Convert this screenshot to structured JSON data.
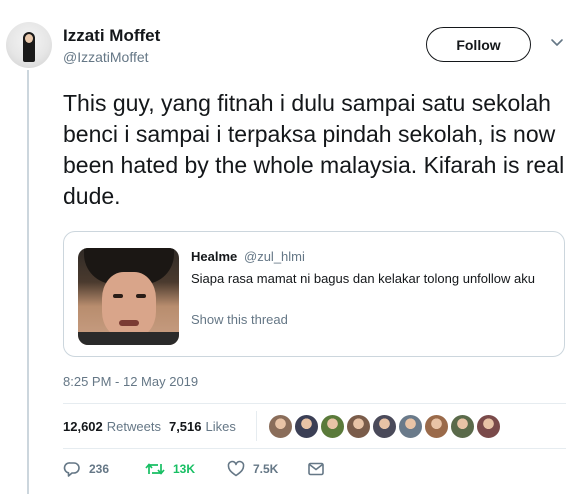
{
  "user": {
    "name": "Izzati Moffet",
    "handle": "@IzzatiMoffet",
    "follow_label": "Follow"
  },
  "tweet": {
    "text": "This guy, yang fitnah i dulu sampai satu sekolah benci i sampai i terpaksa pindah sekolah, is now been hated by the whole malaysia. Kifarah is real dude.",
    "timestamp": "8:25 PM - 12 May 2019"
  },
  "quoted": {
    "name": "Healme",
    "handle": "@zul_hlmi",
    "text": "Siapa rasa mamat ni bagus dan kelakar tolong unfollow aku",
    "show_thread": "Show this thread"
  },
  "stats": {
    "retweets_count": "12,602",
    "retweets_label": "Retweets",
    "likes_count": "7,516",
    "likes_label": "Likes"
  },
  "likers": [
    {
      "color": "#8a6d5a"
    },
    {
      "color": "#3b3f55"
    },
    {
      "color": "#5a7a3a"
    },
    {
      "color": "#7a5c4a"
    },
    {
      "color": "#4a4a5a"
    },
    {
      "color": "#6a7a8a"
    },
    {
      "color": "#9a6a4a"
    },
    {
      "color": "#5a6a4a"
    },
    {
      "color": "#7a4a4a"
    }
  ],
  "actions": {
    "reply_count": "236",
    "retweet_count": "13K",
    "like_count": "7.5K"
  },
  "colors": {
    "text": "#14171a",
    "muted": "#657786",
    "retweet_green": "#17bf63",
    "border": "#ccd6dd"
  },
  "icons": [
    "chevron-down-icon",
    "reply-icon",
    "retweet-icon",
    "like-icon",
    "message-icon"
  ]
}
